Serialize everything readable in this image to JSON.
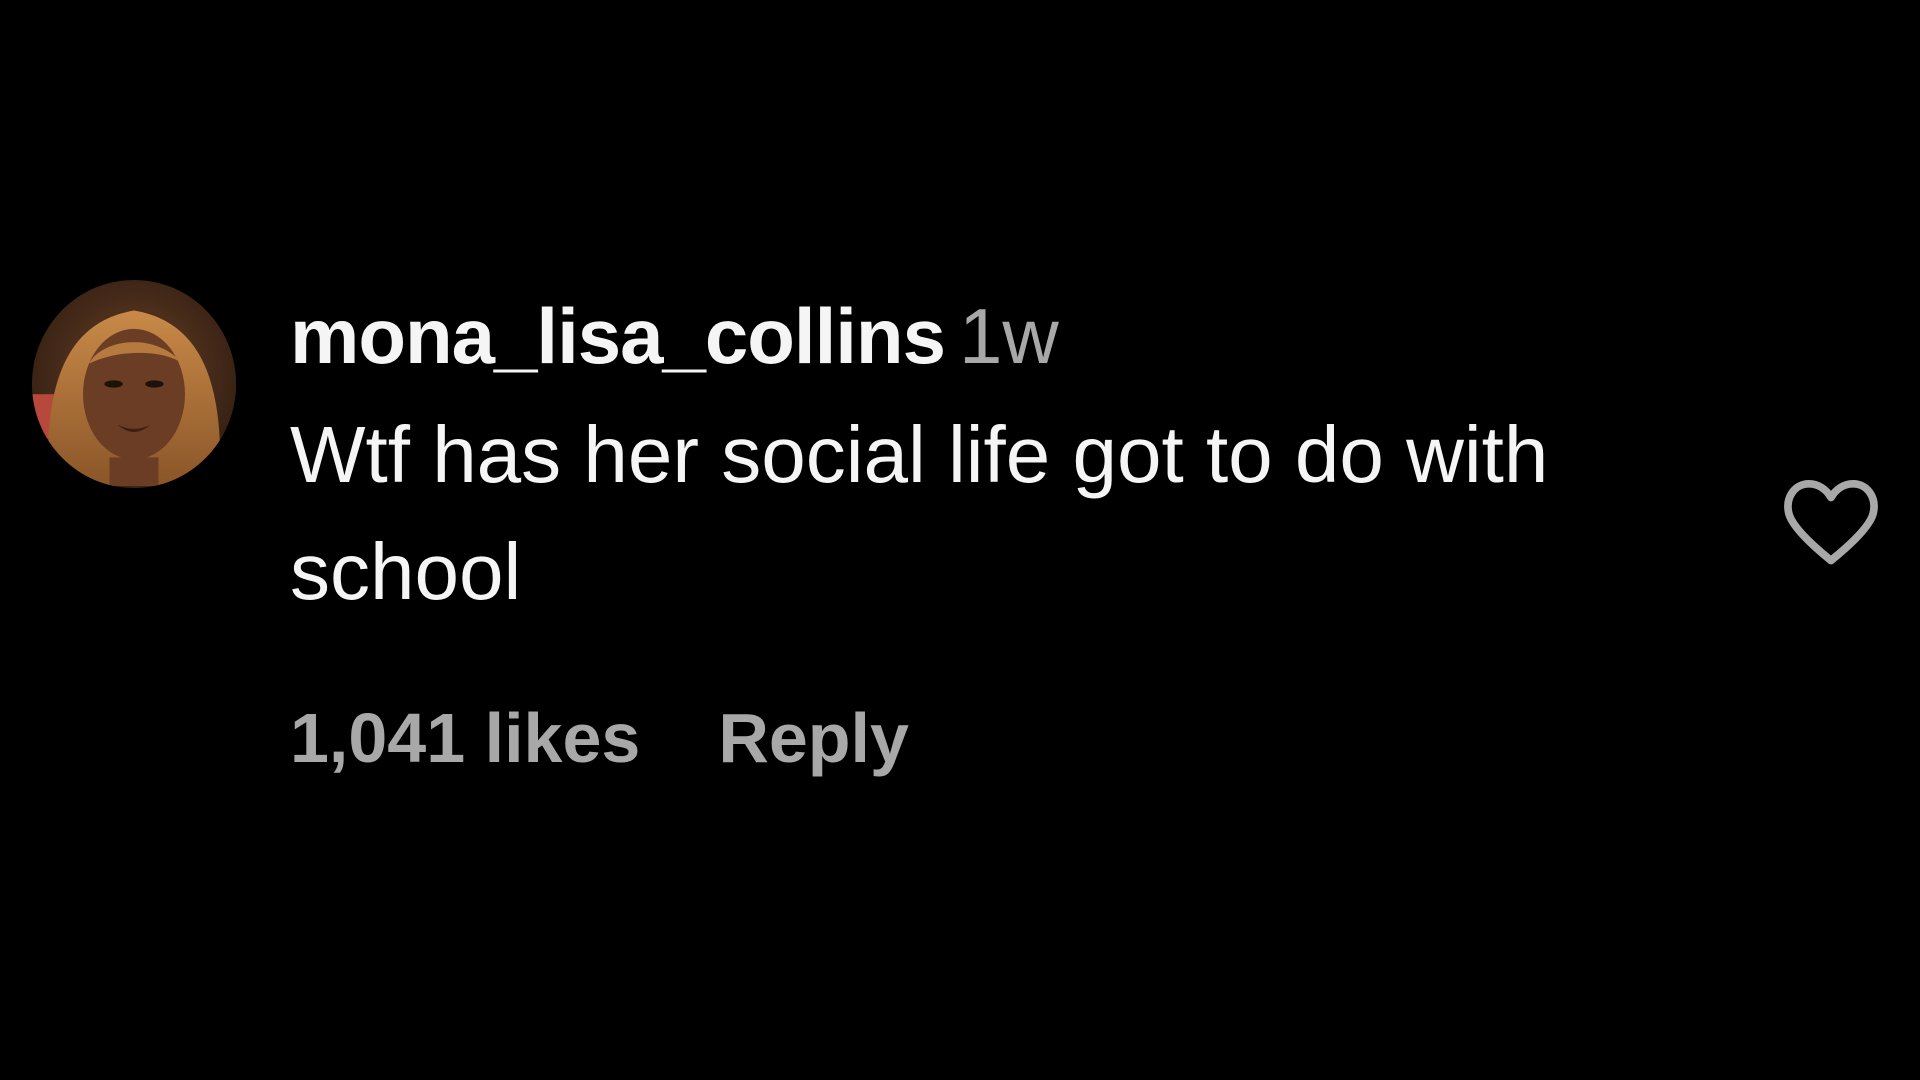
{
  "comment": {
    "username": "mona_lisa_collins",
    "timestamp": "1w",
    "text": "Wtf has her social life got to do with school",
    "likes_label": "1,041 likes",
    "reply_label": "Reply"
  },
  "icons": {
    "like": "heart-outline-icon",
    "avatar": "profile-photo"
  },
  "colors": {
    "background": "#000000",
    "primary_text": "#f5f5f5",
    "secondary_text": "#a8a8a8"
  }
}
